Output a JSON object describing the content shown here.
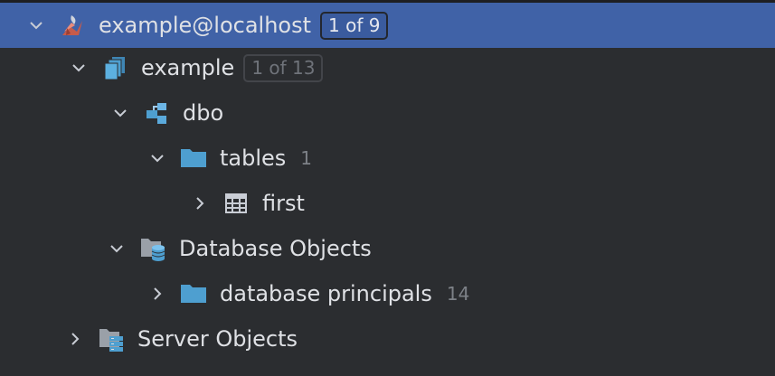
{
  "tree": [
    {
      "label": "example@localhost",
      "badge": "1 of 9",
      "count": "",
      "icon": "sql-server-icon",
      "expanded": true
    },
    {
      "label": "example",
      "badge": "1 of 13",
      "count": "",
      "icon": "database-icon",
      "expanded": true
    },
    {
      "label": "dbo",
      "badge": "",
      "count": "",
      "icon": "schema-icon",
      "expanded": true
    },
    {
      "label": "tables",
      "badge": "",
      "count": "1",
      "icon": "folder-icon",
      "expanded": true
    },
    {
      "label": "first",
      "badge": "",
      "count": "",
      "icon": "table-icon",
      "expanded": false
    },
    {
      "label": "Database Objects",
      "badge": "",
      "count": "",
      "icon": "database-objects-icon",
      "expanded": true
    },
    {
      "label": "database principals",
      "badge": "",
      "count": "14",
      "icon": "folder-icon",
      "expanded": false
    },
    {
      "label": "Server Objects",
      "badge": "",
      "count": "",
      "icon": "server-objects-icon",
      "expanded": false
    }
  ],
  "colors": {
    "background": "#2b2d30",
    "selection": "#4062a7",
    "text": "#dfe1e5",
    "folder": "#4e9fd0"
  }
}
